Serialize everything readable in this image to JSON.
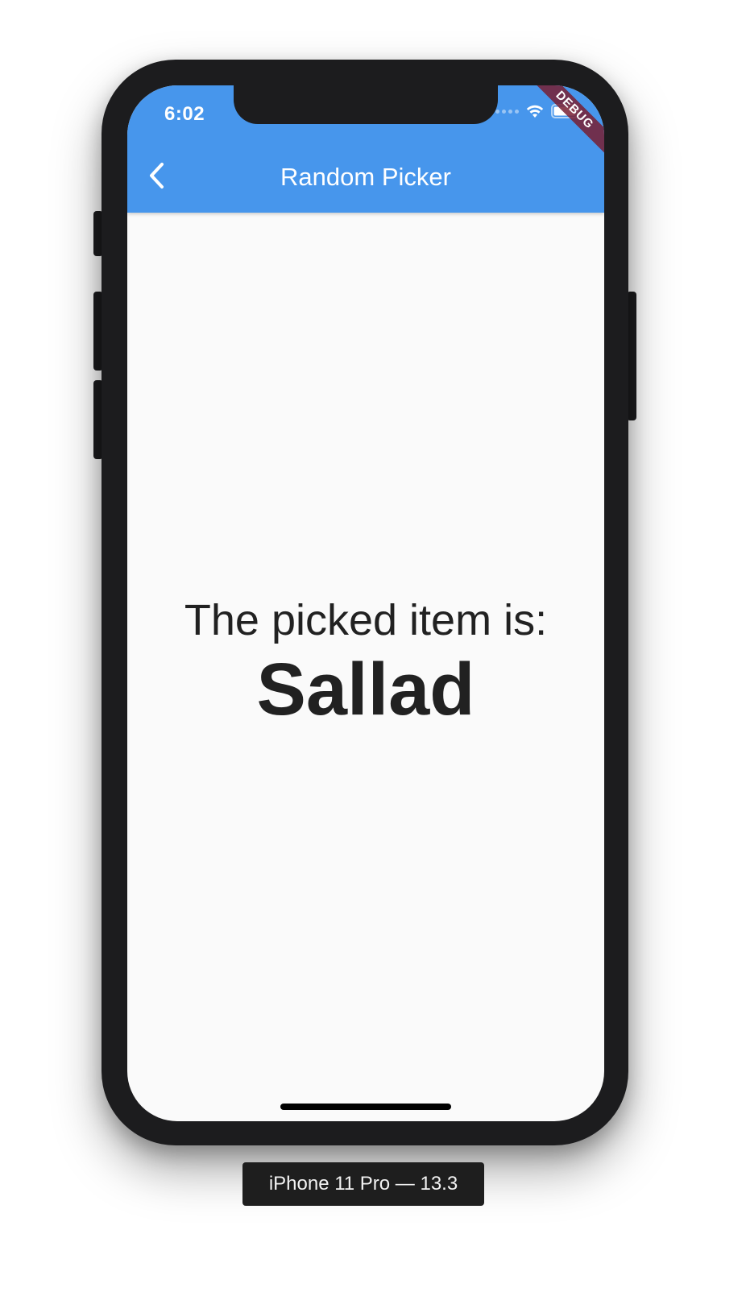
{
  "status_bar": {
    "time": "6:02",
    "wifi_icon": "wifi-icon",
    "battery_icon": "battery-icon"
  },
  "debug_banner": {
    "text": "DEBUG"
  },
  "app_bar": {
    "title": "Random Picker",
    "back_icon": "chevron-left-icon",
    "background_color": "#4796ec"
  },
  "body": {
    "label": "The picked item is:",
    "picked_item": "Sallad"
  },
  "device_label": {
    "text": "iPhone 11 Pro — 13.3"
  }
}
